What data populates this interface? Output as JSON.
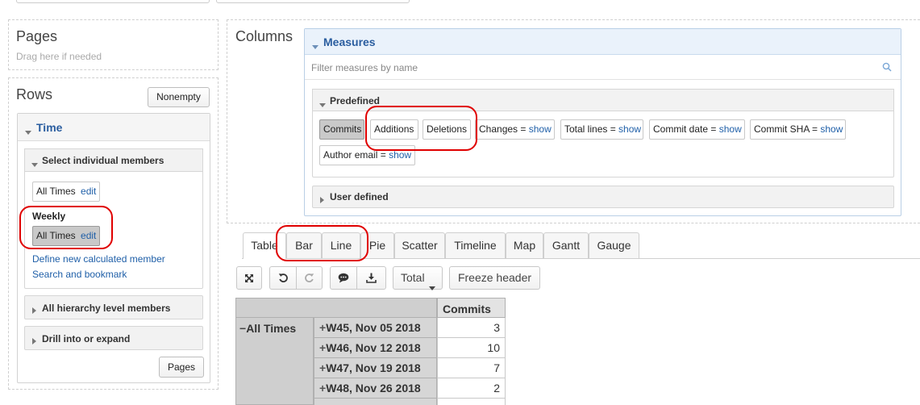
{
  "pages": {
    "title": "Pages",
    "hint": "Drag here if needed"
  },
  "rows": {
    "title": "Rows",
    "nonempty_label": "Nonempty",
    "time": {
      "title": "Time",
      "select_individual": "Select individual members",
      "member1": {
        "label": "All Times",
        "edit": "edit"
      },
      "weekly_label": "Weekly",
      "member2": {
        "label": "All Times",
        "edit": "edit"
      },
      "define_calculated": "Define new calculated member",
      "search_bookmark": "Search and bookmark",
      "all_hierarchy": "All hierarchy level members",
      "drill": "Drill into or expand",
      "pages_button": "Pages"
    }
  },
  "columns": {
    "title": "Columns",
    "measures_title": "Measures",
    "filter_placeholder": "Filter measures by name",
    "predefined_title": "Predefined",
    "user_defined_title": "User defined",
    "show": "show",
    "measures": {
      "commits": "Commits",
      "additions": "Additions",
      "deletions": "Deletions",
      "changes": "Changes =",
      "total_lines": "Total lines =",
      "commit_date": "Commit date =",
      "commit_sha": "Commit SHA =",
      "author_email": "Author email ="
    }
  },
  "tabs": [
    "Table",
    "Bar",
    "Line",
    "Pie",
    "Scatter",
    "Timeline",
    "Map",
    "Gantt",
    "Gauge"
  ],
  "toolbar": {
    "total_label": "Total",
    "freeze_label": "Freeze header"
  },
  "table": {
    "header": "Commits",
    "group": "All Times",
    "rows": [
      {
        "label": "W45, Nov 05 2018",
        "value": "3"
      },
      {
        "label": "W46, Nov 12 2018",
        "value": "10"
      },
      {
        "label": "W47, Nov 19 2018",
        "value": "7"
      },
      {
        "label": "W48, Nov 26 2018",
        "value": "2"
      }
    ]
  },
  "colors": {
    "accent": "#2a5d9f",
    "highlight": "#e00000",
    "link": "#1f5fa8"
  }
}
